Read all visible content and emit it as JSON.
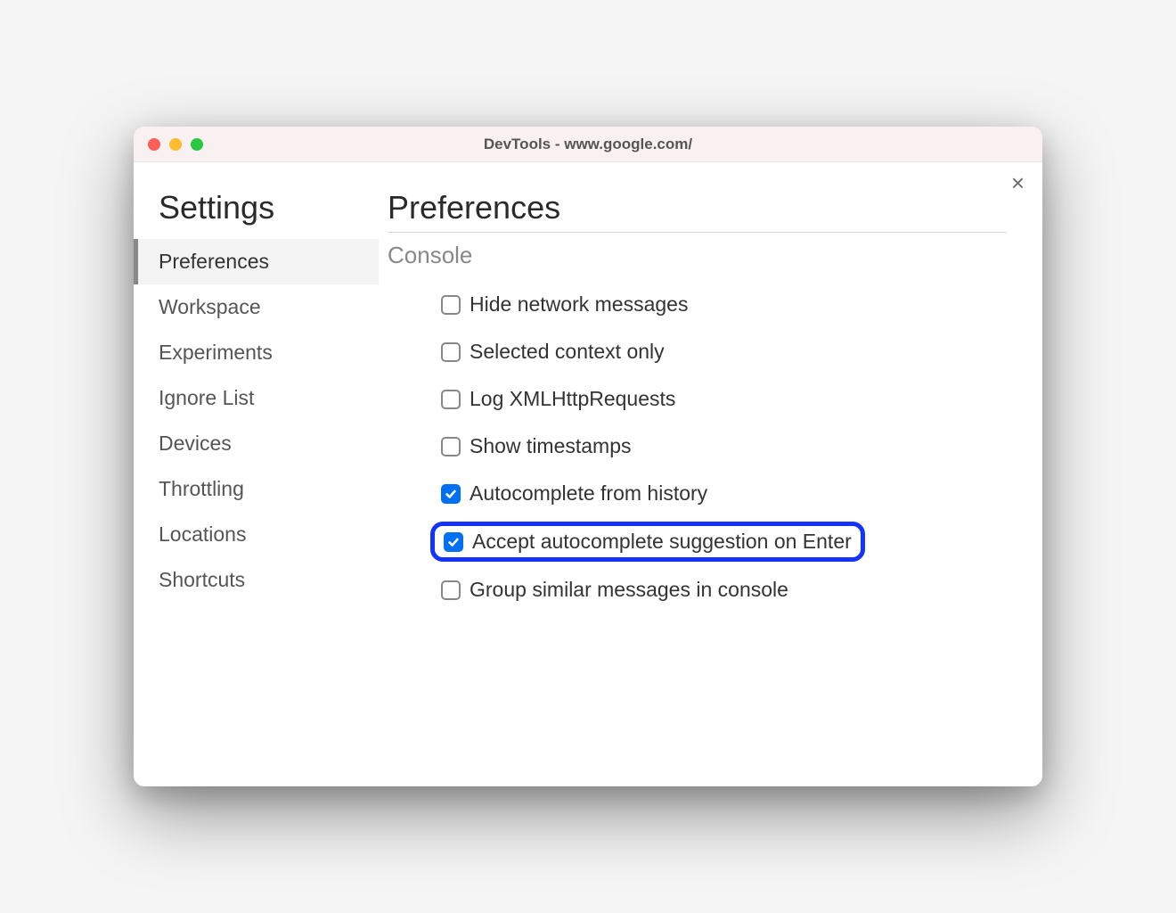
{
  "window": {
    "title": "DevTools - www.google.com/"
  },
  "sidebar": {
    "title": "Settings",
    "items": [
      {
        "label": "Preferences",
        "active": true
      },
      {
        "label": "Workspace",
        "active": false
      },
      {
        "label": "Experiments",
        "active": false
      },
      {
        "label": "Ignore List",
        "active": false
      },
      {
        "label": "Devices",
        "active": false
      },
      {
        "label": "Throttling",
        "active": false
      },
      {
        "label": "Locations",
        "active": false
      },
      {
        "label": "Shortcuts",
        "active": false
      }
    ]
  },
  "main": {
    "title": "Preferences",
    "section": "Console",
    "options": [
      {
        "label": "Hide network messages",
        "checked": false,
        "highlighted": false
      },
      {
        "label": "Selected context only",
        "checked": false,
        "highlighted": false
      },
      {
        "label": "Log XMLHttpRequests",
        "checked": false,
        "highlighted": false
      },
      {
        "label": "Show timestamps",
        "checked": false,
        "highlighted": false
      },
      {
        "label": "Autocomplete from history",
        "checked": true,
        "highlighted": false
      },
      {
        "label": "Accept autocomplete suggestion on Enter",
        "checked": true,
        "highlighted": true
      },
      {
        "label": "Group similar messages in console",
        "checked": false,
        "highlighted": false
      }
    ]
  },
  "colors": {
    "highlight_border": "#1433ff",
    "checkbox_checked": "#0070f3"
  }
}
